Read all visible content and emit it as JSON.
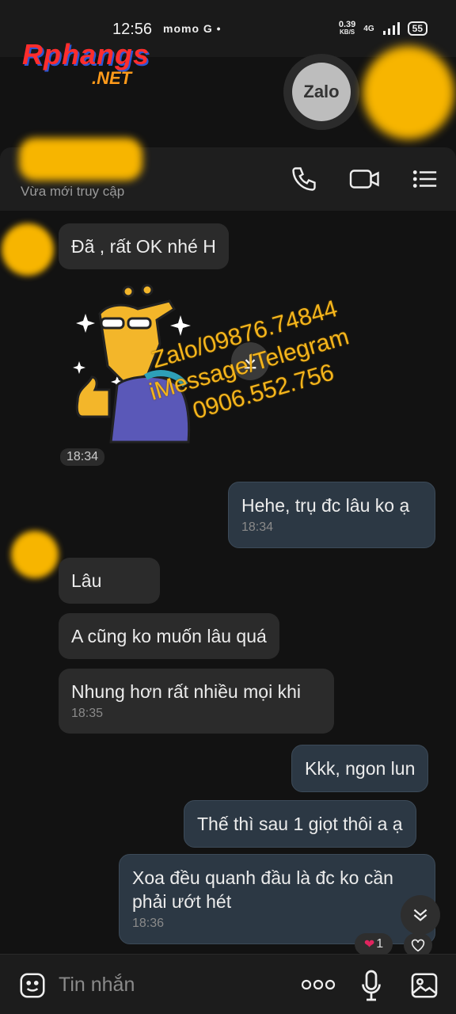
{
  "status_bar": {
    "time": "12:56",
    "left_icons": "momo G •",
    "net_speed_top": "0.39",
    "net_speed_unit": "KB/S",
    "network": "4G",
    "battery": "55"
  },
  "watermark": {
    "logo_main": "Rphangs",
    "logo_sub": ".NET",
    "contact_line1": "Zalo/09876.74844",
    "contact_line2": "iMessage/Telegram",
    "contact_line3": "0906.552.756"
  },
  "header": {
    "status": "Vừa mới truy cập",
    "zalo_badge": "Zalo"
  },
  "messages": [
    {
      "side": "in",
      "text": "Đã , rất OK nhé H",
      "time": ""
    },
    {
      "side": "sticker",
      "time": "18:34"
    },
    {
      "side": "out",
      "text": "Hehe, trụ đc lâu ko ạ",
      "time": "18:34"
    },
    {
      "side": "in",
      "text": "Lâu",
      "time": ""
    },
    {
      "side": "in",
      "text": "A cũng ko muốn lâu quá",
      "time": ""
    },
    {
      "side": "in",
      "text": "Nhung hơn rất nhiều mọi khi",
      "time": "18:35"
    },
    {
      "side": "out",
      "text": "Kkk, ngon lun",
      "time": ""
    },
    {
      "side": "out",
      "text": "Thế thì sau 1 giọt thôi a ạ",
      "time": ""
    },
    {
      "side": "out",
      "text": "Xoa đều quanh đầu là đc ko cần phải ướt hét",
      "time": "18:36"
    }
  ],
  "reaction": {
    "count": "1"
  },
  "input": {
    "placeholder": "Tin nhắn"
  },
  "colors": {
    "incoming": "#2b2b2b",
    "outgoing": "#2c3844",
    "background": "#121212",
    "accent": "#f7b500"
  }
}
